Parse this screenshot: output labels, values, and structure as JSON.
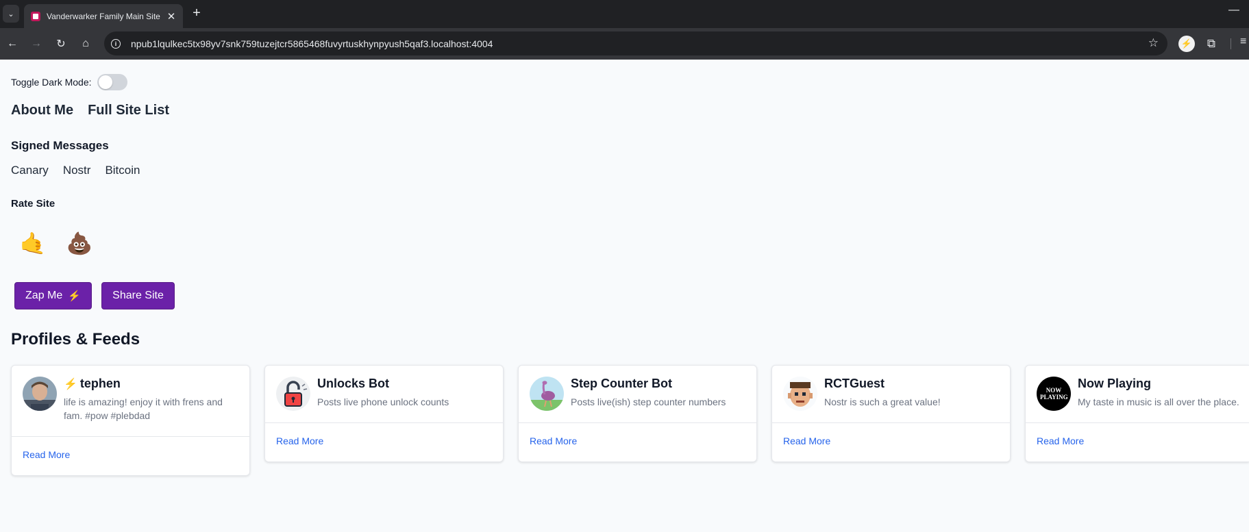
{
  "browser": {
    "tab_title": "Vanderwarker Family Main Site",
    "url": "npub1lqulkec5tx98yv7snk759tuzejtcr5865468fuvyrtuskhynpyush5qaf3.localhost:4004"
  },
  "page": {
    "dark_mode_label": "Toggle Dark Mode:",
    "top_links": [
      "About Me",
      "Full Site List"
    ],
    "signed_heading": "Signed Messages",
    "signed_links": [
      "Canary",
      "Nostr",
      "Bitcoin"
    ],
    "rate_heading": "Rate Site",
    "rate_options": [
      "🤙",
      "💩"
    ],
    "zap_label": "Zap Me",
    "share_label": "Share Site",
    "profiles_heading": "Profiles & Feeds"
  },
  "profiles": [
    {
      "name": "tephen",
      "description": "life is amazing! enjoy it with frens and fam. #pow #plebdad",
      "read_more": "Read More",
      "avatar": "person-photo"
    },
    {
      "name": "Unlocks Bot",
      "description": "Posts live phone unlock counts",
      "read_more": "Read More",
      "avatar": "padlock-icon"
    },
    {
      "name": "Step Counter Bot",
      "description": "Posts live(ish) step counter numbers",
      "read_more": "Read More",
      "avatar": "ostrich-icon"
    },
    {
      "name": "RCTGuest",
      "description": "Nostr is such a great value!",
      "read_more": "Read More",
      "avatar": "pixel-face-icon"
    },
    {
      "name": "Now Playing",
      "description": "My taste in music is all over the place.",
      "read_more": "Read More",
      "avatar": "now-playing-logo",
      "avatar_text": "NOW PLAYING"
    }
  ],
  "colors": {
    "button_purple": "#6b21a8",
    "link_blue": "#2563eb",
    "page_bg": "#f8fafc"
  }
}
